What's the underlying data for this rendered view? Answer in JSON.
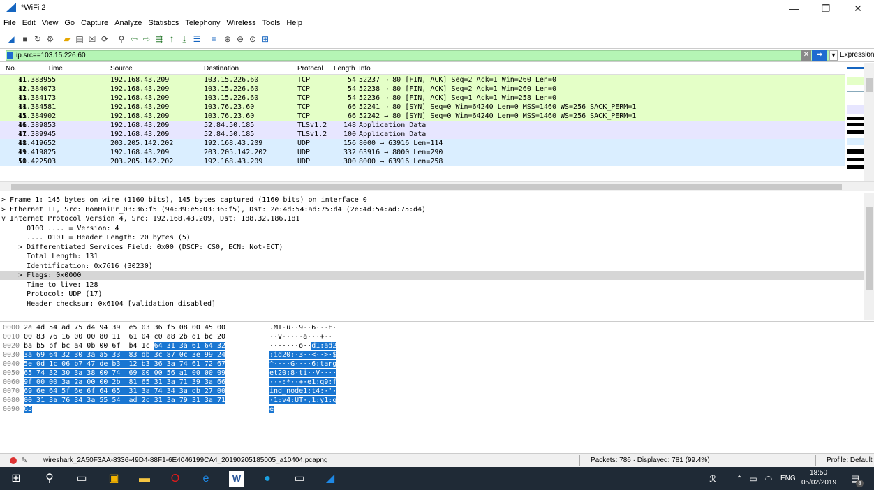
{
  "window": {
    "title": "*WiFi 2",
    "minimize": "—",
    "maximize": "❐",
    "close": "✕"
  },
  "menu": [
    "File",
    "Edit",
    "View",
    "Go",
    "Capture",
    "Analyze",
    "Statistics",
    "Telephony",
    "Wireless",
    "Tools",
    "Help"
  ],
  "toolbar_icons": [
    "shark-fin-icon",
    "stop-icon",
    "restart-icon",
    "options-icon",
    "open-file-icon",
    "save-file-icon",
    "close-file-icon",
    "reload-icon",
    "find-icon",
    "back-icon",
    "forward-icon",
    "goto-icon",
    "first-icon",
    "last-icon",
    "autoscroll-icon",
    "colorize-icon",
    "zoom-in-icon",
    "zoom-out-icon",
    "zoom-reset-icon",
    "resize-columns-icon"
  ],
  "filter": {
    "value": "ip.src==103.15.226.60",
    "expression_label": "Expression...",
    "plus": "+"
  },
  "packet_list": {
    "columns": [
      "No.",
      "Time",
      "Source",
      "Destination",
      "Protocol",
      "Length",
      "Info"
    ],
    "rows": [
      {
        "no": "41",
        "time": "11.383955",
        "src": "192.168.43.209",
        "dst": "103.15.226.60",
        "proto": "TCP",
        "len": "54",
        "info": "52237 → 80 [FIN, ACK] Seq=2 Ack=1 Win=260 Len=0",
        "color": "#e4ffc7"
      },
      {
        "no": "42",
        "time": "11.384073",
        "src": "192.168.43.209",
        "dst": "103.15.226.60",
        "proto": "TCP",
        "len": "54",
        "info": "52238 → 80 [FIN, ACK] Seq=2 Ack=1 Win=260 Len=0",
        "color": "#e4ffc7"
      },
      {
        "no": "43",
        "time": "11.384173",
        "src": "192.168.43.209",
        "dst": "103.15.226.60",
        "proto": "TCP",
        "len": "54",
        "info": "52236 → 80 [FIN, ACK] Seq=1 Ack=1 Win=258 Len=0",
        "color": "#e4ffc7"
      },
      {
        "no": "44",
        "time": "11.384581",
        "src": "192.168.43.209",
        "dst": "103.76.23.60",
        "proto": "TCP",
        "len": "66",
        "info": "52241 → 80 [SYN] Seq=0 Win=64240 Len=0 MSS=1460 WS=256 SACK_PERM=1",
        "color": "#e4ffc7"
      },
      {
        "no": "45",
        "time": "11.384902",
        "src": "192.168.43.209",
        "dst": "103.76.23.60",
        "proto": "TCP",
        "len": "66",
        "info": "52242 → 80 [SYN] Seq=0 Win=64240 Len=0 MSS=1460 WS=256 SACK_PERM=1",
        "color": "#e4ffc7"
      },
      {
        "no": "46",
        "time": "11.389853",
        "src": "192.168.43.209",
        "dst": "52.84.50.185",
        "proto": "TLSv1.2",
        "len": "148",
        "info": "Application Data",
        "color": "#e7e6ff"
      },
      {
        "no": "47",
        "time": "11.389945",
        "src": "192.168.43.209",
        "dst": "52.84.50.185",
        "proto": "TLSv1.2",
        "len": "100",
        "info": "Application Data",
        "color": "#e7e6ff"
      },
      {
        "no": "48",
        "time": "11.419652",
        "src": "203.205.142.202",
        "dst": "192.168.43.209",
        "proto": "UDP",
        "len": "156",
        "info": "8000 → 63916 Len=114",
        "color": "#daeeff"
      },
      {
        "no": "49",
        "time": "11.419825",
        "src": "192.168.43.209",
        "dst": "203.205.142.202",
        "proto": "UDP",
        "len": "332",
        "info": "63916 → 8000 Len=290",
        "color": "#daeeff"
      },
      {
        "no": "50",
        "time": "11.422503",
        "src": "203.205.142.202",
        "dst": "192.168.43.209",
        "proto": "UDP",
        "len": "300",
        "info": "8000 → 63916 Len=258",
        "color": "#daeeff"
      }
    ]
  },
  "details": [
    {
      "text": "> Frame 1: 145 bytes on wire (1160 bits), 145 bytes captured (1160 bits) on interface 0",
      "sel": false
    },
    {
      "text": "> Ethernet II, Src: HonHaiPr_03:36:f5 (94:39:e5:03:36:f5), Dst: 2e:4d:54:ad:75:d4 (2e:4d:54:ad:75:d4)",
      "sel": false
    },
    {
      "text": "v Internet Protocol Version 4, Src: 192.168.43.209, Dst: 188.32.186.181",
      "sel": false
    },
    {
      "text": "      0100 .... = Version: 4",
      "sel": false
    },
    {
      "text": "      .... 0101 = Header Length: 20 bytes (5)",
      "sel": false
    },
    {
      "text": "    > Differentiated Services Field: 0x00 (DSCP: CS0, ECN: Not-ECT)",
      "sel": false
    },
    {
      "text": "      Total Length: 131",
      "sel": false
    },
    {
      "text": "      Identification: 0x7616 (30230)",
      "sel": false
    },
    {
      "text": "    > Flags: 0x0000",
      "sel": true
    },
    {
      "text": "      Time to live: 128",
      "sel": false
    },
    {
      "text": "      Protocol: UDP (17)",
      "sel": false
    },
    {
      "text": "      Header checksum: 0x6104 [validation disabled]",
      "sel": false
    }
  ],
  "bytes": [
    {
      "off": "0000",
      "hex": "2e 4d 54 ad 75 d4 94 39  e5 03 36 f5 08 00 45 00",
      "ascii": ".MT·u··9 ··6···E·",
      "hl_from": 99
    },
    {
      "off": "0010",
      "hex": "00 83 76 16 00 00 80 11  61 04 c0 a8 2b d1 bc 20",
      "ascii": "··v····· a···+·· ",
      "hl_from": 99
    },
    {
      "off": "0020",
      "hex": "ba b5 bf bc a4 0b 00 6f  b4 1c 64 31 3a 61 64 32",
      "ascii": "·······o ··d1:ad2",
      "hl_from": 10
    },
    {
      "off": "0030",
      "hex": "3a 69 64 32 30 3a a5 33  83 db 3c 87 0c 3e 99 24",
      "ascii": ":id20:·3 ··<··>·$",
      "hl_from": 0
    },
    {
      "off": "0040",
      "hex": "5e 0d 1c 06 b7 47 de b3  12 b3 36 3a 74 61 72 67",
      "ascii": "^····G·· ··6:targ",
      "hl_from": 0
    },
    {
      "off": "0050",
      "hex": "65 74 32 30 3a 38 00 74  69 00 00 56 a1 00 00 09",
      "ascii": "et20:8·t i··V····",
      "hl_from": 0
    },
    {
      "off": "0060",
      "hex": "9f 00 00 3a 2a 00 00 2b  81 65 31 3a 71 39 3a 66",
      "ascii": "···:*··+ ·e1:q9:f",
      "hl_from": 0
    },
    {
      "off": "0070",
      "hex": "69 6e 64 5f 6e 6f 64 65  31 3a 74 34 3a db 27 00",
      "ascii": "ind_node 1:t4:·'·",
      "hl_from": 0
    },
    {
      "off": "0080",
      "hex": "00 31 3a 76 34 3a 55 54  ad 2c 31 3a 79 31 3a 71",
      "ascii": "·1:v4:UT ·,1:y1:q",
      "hl_from": 0
    },
    {
      "off": "0090",
      "hex": "65",
      "ascii": "e",
      "hl_from": 0
    }
  ],
  "status": {
    "file": "wireshark_2A50F3AA-8336-49D4-88F1-6E4046199CA4_20190205185005_a10404.pcapng",
    "packets": "Packets: 786 · Displayed: 781 (99.4%)",
    "profile": "Profile: Default"
  },
  "taskbar": {
    "time": "18:50",
    "date": "05/02/2019",
    "lang": "ENG",
    "notif": "8"
  }
}
